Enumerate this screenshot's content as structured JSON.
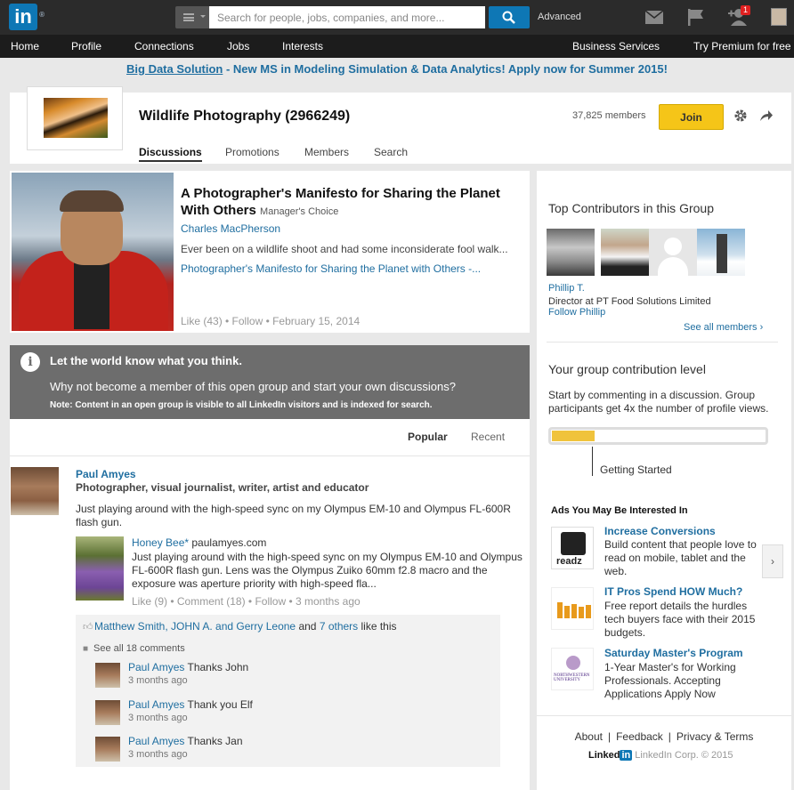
{
  "topbar": {
    "logo": "in",
    "search_placeholder": "Search for people, jobs, companies, and more...",
    "advanced": "Advanced",
    "notification_count": "1"
  },
  "nav": {
    "left": [
      "Home",
      "Profile",
      "Connections",
      "Jobs",
      "Interests"
    ],
    "right": [
      "Business Services",
      "Try Premium for free"
    ]
  },
  "banner": {
    "link": "Big Data Solution",
    "text": " - New MS in Modeling Simulation & Data Analytics! Apply now for Summer 2015!"
  },
  "group": {
    "title": "Wildlife Photography (2966249)",
    "members": "37,825 members",
    "join": "Join",
    "tabs": [
      "Discussions",
      "Promotions",
      "Members",
      "Search"
    ]
  },
  "featured": {
    "title": "A Photographer's Manifesto for Sharing the Planet With Others",
    "badge": "Manager's Choice",
    "author": "Charles MacPherson",
    "excerpt": "Ever been on a wildlife shoot and had some inconsiderate fool walk...",
    "link": "Photographer's Manifesto for Sharing the Planet with Others -...",
    "meta": "Like (43)  • Follow  • February 15, 2014"
  },
  "notice": {
    "heading": "Let the world know what you think.",
    "text": "Why not become a member of this open group and start your own discussions?",
    "note": "Note: Content in an open group is visible to all LinkedIn visitors and is indexed for search."
  },
  "feed": {
    "sort_popular": "Popular",
    "sort_recent": "Recent",
    "post": {
      "author": "Paul Amyes",
      "headline": "Photographer, visual journalist, writer, artist and educator",
      "text": "Just playing around with the high-speed sync on my Olympus EM-10 and Olympus FL-600R flash gun.",
      "share_title": "Honey Bee*",
      "share_domain": " paulamyes.com",
      "share_text": "Just playing around with the high-speed sync on my Olympus EM-10 and Olympus FL-600R flash gun. Lens was the Olympus Zuiko 60mm f2.8 macro and the exposure was aperture priority with high-speed fla...",
      "meta": "Like (9)  • Comment (18)  • Follow  • 3 months ago",
      "likers": "Matthew Smith, JOHN A. and Gerry Leone",
      "and": " and ",
      "others": "7 others",
      "like_this": " like this",
      "see_comments": "See all 18 comments",
      "comments": [
        {
          "author": "Paul Amyes",
          "text": " Thanks John",
          "time": "3 months ago"
        },
        {
          "author": "Paul Amyes",
          "text": " Thank you Elf",
          "time": "3 months ago"
        },
        {
          "author": "Paul Amyes",
          "text": " Thanks Jan",
          "time": "3 months ago"
        }
      ]
    }
  },
  "sidebar": {
    "top_contributors_title": "Top Contributors in this Group",
    "contributor_name": "Phillip T.",
    "contributor_role": "Director at PT Food Solutions Limited",
    "contributor_follow": "Follow Phillip",
    "see_all": "See all members  ›",
    "contribution_title": "Your group contribution level",
    "contribution_text": "Start by commenting in a discussion. Group participants get 4x the number of profile views.",
    "contribution_level": "Getting Started",
    "contribution_fraction": 0.2,
    "ads_title": "Ads You May Be Interested In",
    "ads": [
      {
        "title": "Increase Conversions",
        "text": "Build content that people love to read on mobile, tablet and the web.",
        "logo": "readz"
      },
      {
        "title": "IT Pros Spend HOW Much?",
        "text": "Free report details the hurdles tech buyers face with their 2015 budgets."
      },
      {
        "title": "Saturday Master's Program",
        "text": "1-Year Master's for Working Professionals. Accepting Applications Apply Now",
        "logo": "NORTHWESTERN UNIVERSITY"
      }
    ],
    "ads_next": "›",
    "footer_links": [
      "About",
      "Feedback",
      "Privacy & Terms"
    ],
    "footer_brand_a": "Linked",
    "footer_brand_b": "in",
    "footer_copy": " LinkedIn Corp. © 2015"
  },
  "colors": {
    "brand": "#0e77b5",
    "join": "#f5c518",
    "notice": "#6d6d6d",
    "link": "#1f6ea0"
  }
}
